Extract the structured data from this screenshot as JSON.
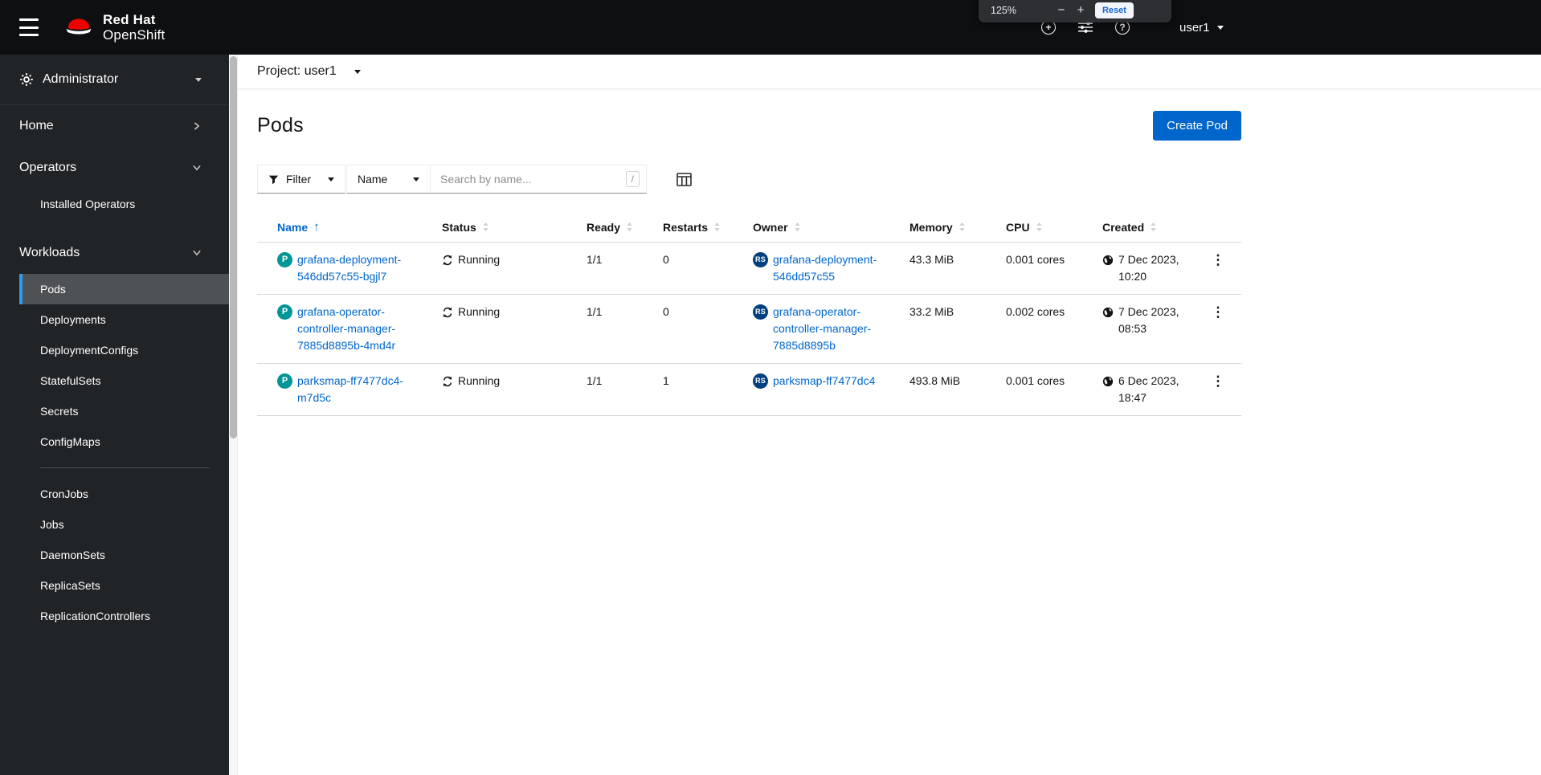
{
  "colors": {
    "accent": "#0066cc",
    "link": "#0066cc",
    "pod_badge_bg": "#009596",
    "replicaset_badge_bg": "#004080",
    "nav_active_border": "#2b9af3",
    "masthead_bg": "#0e0f11",
    "sidebar_bg": "#212427"
  },
  "icons": {
    "hamburger": "menu",
    "logo": "red-hat-fedora",
    "plus_circle": "+",
    "help_circle": "?",
    "sliders": "sliders",
    "caret_down": "caret-down",
    "gear": "gear",
    "chevron": "chevron",
    "filter_funnel": "funnel",
    "sort_asc": "↑",
    "sort_both": "sort-arrows",
    "status_sync": "sync-arrows",
    "created_globe": "globe",
    "kebab": "⋮",
    "columns_manage": "table-columns"
  },
  "masthead": {
    "logo_line1": "Red Hat",
    "logo_line2": "OpenShift",
    "user": "user1"
  },
  "zoom_popup": {
    "level": "125%",
    "minus": "−",
    "plus": "+",
    "reset": "Reset"
  },
  "sidebar": {
    "perspective": "Administrator",
    "home": "Home",
    "operators": "Operators",
    "operators_children": [
      "Installed Operators"
    ],
    "workloads": "Workloads",
    "workloads_children": [
      "Pods",
      "Deployments",
      "DeploymentConfigs",
      "StatefulSets",
      "Secrets",
      "ConfigMaps",
      "CronJobs",
      "Jobs",
      "DaemonSets",
      "ReplicaSets",
      "ReplicationControllers"
    ],
    "active_item": "Pods"
  },
  "project_bar": {
    "label": "Project: user1"
  },
  "page": {
    "title": "Pods",
    "create_button": "Create Pod"
  },
  "toolbar": {
    "filter": "Filter",
    "name_select": "Name",
    "search_placeholder": "Search by name...",
    "shortcut": "/"
  },
  "table": {
    "columns": [
      "Name",
      "Status",
      "Ready",
      "Restarts",
      "Owner",
      "Memory",
      "CPU",
      "Created"
    ],
    "rows": [
      {
        "badge": "P",
        "name": "grafana-deployment-546dd57c55-bgjl7",
        "status": "Running",
        "ready": "1/1",
        "restarts": "0",
        "owner_badge": "RS",
        "owner": "grafana-deployment-546dd57c55",
        "memory": "43.3 MiB",
        "cpu": "0.001 cores",
        "created": "7 Dec 2023, 10:20"
      },
      {
        "badge": "P",
        "name": "grafana-operator-controller-manager-7885d8895b-4md4r",
        "status": "Running",
        "ready": "1/1",
        "restarts": "0",
        "owner_badge": "RS",
        "owner": "grafana-operator-controller-manager-7885d8895b",
        "memory": "33.2 MiB",
        "cpu": "0.002 cores",
        "created": "7 Dec 2023, 08:53"
      },
      {
        "badge": "P",
        "name": "parksmap-ff7477dc4-m7d5c",
        "status": "Running",
        "ready": "1/1",
        "restarts": "1",
        "owner_badge": "RS",
        "owner": "parksmap-ff7477dc4",
        "memory": "493.8 MiB",
        "cpu": "0.001 cores",
        "created": "6 Dec 2023, 18:47"
      }
    ]
  }
}
